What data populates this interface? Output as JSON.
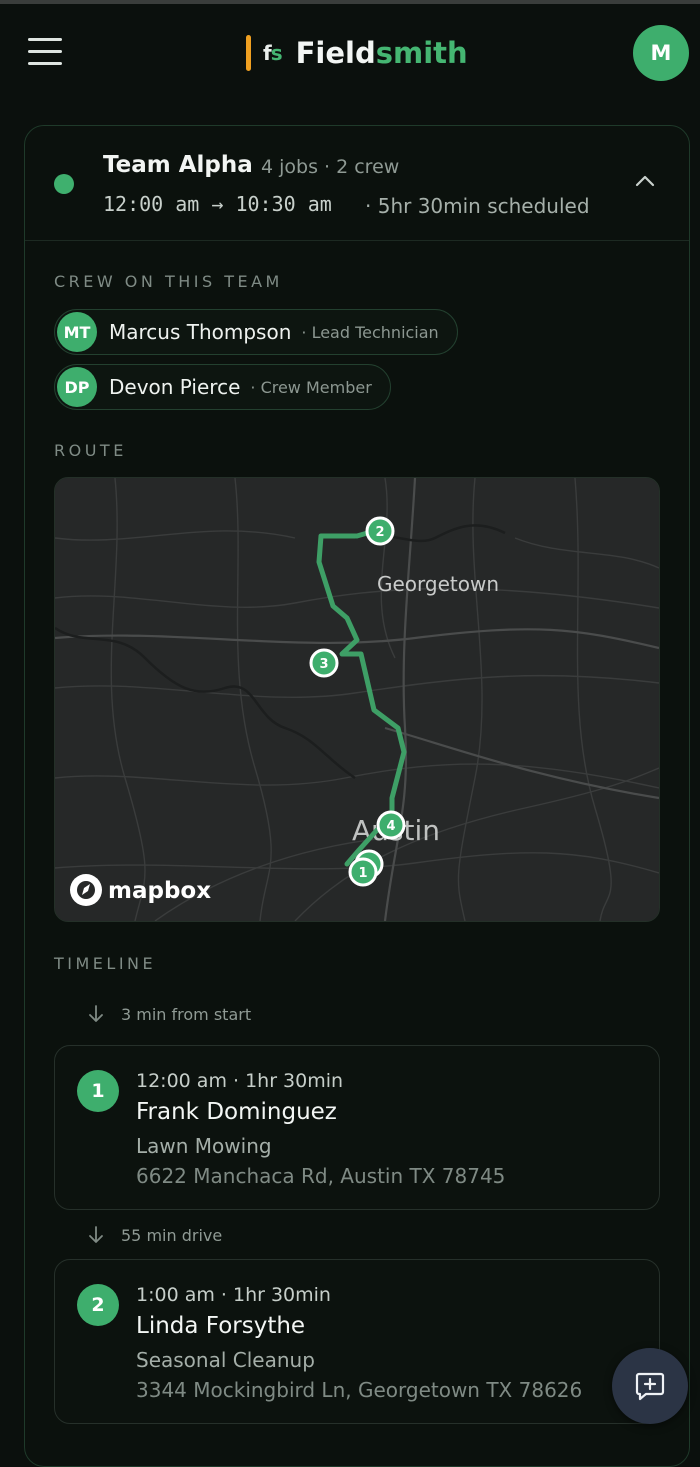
{
  "header": {
    "brand_mark_f": "f",
    "brand_mark_s": "s",
    "brand_name_1": "Field",
    "brand_name_2": "smith",
    "avatar_initial": "M",
    "menu_icon": "hamburger-menu-icon"
  },
  "team": {
    "name": "Team Alpha",
    "meta": "4 jobs · 2 crew",
    "time_range": "12:00 am → 10:30 am",
    "scheduled": "· 5hr 30min scheduled",
    "status_color": "#3fb06e",
    "collapse_icon": "chevron-up-icon"
  },
  "crew_section": {
    "label": "CREW ON THIS TEAM",
    "members": [
      {
        "initials": "MT",
        "name": "Marcus Thompson",
        "role": "· Lead Technician"
      },
      {
        "initials": "DP",
        "name": "Devon Pierce",
        "role": "· Crew Member"
      }
    ]
  },
  "route_section": {
    "label": "ROUTE",
    "map": {
      "city_labels": [
        "Georgetown",
        "Austin"
      ],
      "stops": [
        "1",
        "2",
        "3",
        "4"
      ],
      "attribution": "mapbox",
      "route_color": "#3e9f66"
    }
  },
  "timeline": {
    "label": "TIMELINE",
    "deltas": [
      "3 min from start",
      "55 min drive"
    ],
    "jobs": [
      {
        "number": "1",
        "time": "12:00 am · 1hr 30min",
        "client": "Frank Dominguez",
        "service": "Lawn Mowing",
        "address": "6622 Manchaca Rd, Austin TX 78745"
      },
      {
        "number": "2",
        "time": "1:00 am · 1hr 30min",
        "client": "Linda Forsythe",
        "service": "Seasonal Cleanup",
        "address": "3344 Mockingbird Ln, Georgetown TX 78626"
      }
    ]
  },
  "fab": {
    "icon": "add-message-icon"
  },
  "colors": {
    "accent": "#3eae6d",
    "brand_bar": "#f0a021",
    "background": "#0b100d"
  }
}
